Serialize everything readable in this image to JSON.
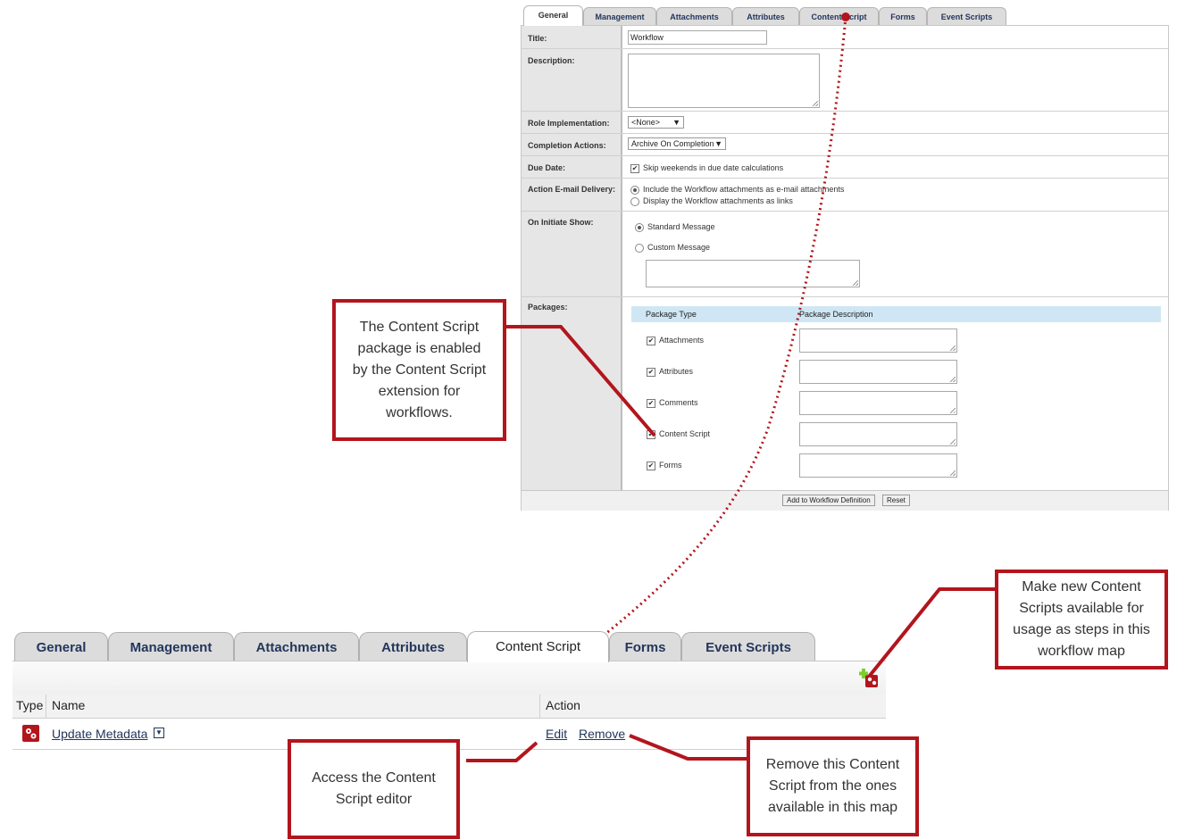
{
  "top": {
    "tabs": [
      {
        "label": "General",
        "active": true
      },
      {
        "label": "Management"
      },
      {
        "label": "Attachments"
      },
      {
        "label": "Attributes"
      },
      {
        "label": "Content Script"
      },
      {
        "label": "Forms"
      },
      {
        "label": "Event Scripts"
      }
    ],
    "form": {
      "title_label": "Title:",
      "title_value": "Workflow",
      "description_label": "Description:",
      "role_label": "Role Implementation:",
      "role_value": "<None>",
      "completion_label": "Completion Actions:",
      "completion_value": "Archive On Completion",
      "due_label": "Due Date:",
      "due_checkbox": "Skip weekends in due date calculations",
      "email_label": "Action E-mail Delivery:",
      "email_opt1": "Include the Workflow attachments as e-mail attachments",
      "email_opt2": "Display the Workflow attachments as links",
      "initiate_label": "On Initiate Show:",
      "initiate_opt1": "Standard Message",
      "initiate_opt2": "Custom Message",
      "packages_label": "Packages:",
      "pkg_col_type": "Package Type",
      "pkg_col_desc": "Package Description",
      "packages": [
        "Attachments",
        "Attributes",
        "Comments",
        "Content Script",
        "Forms"
      ],
      "add_button": "Add to Workflow Definition",
      "reset_button": "Reset"
    }
  },
  "bottom": {
    "tabs": [
      {
        "label": "General"
      },
      {
        "label": "Management"
      },
      {
        "label": "Attachments"
      },
      {
        "label": "Attributes"
      },
      {
        "label": "Content Script",
        "active": true
      },
      {
        "label": "Forms"
      },
      {
        "label": "Event Scripts"
      }
    ],
    "columns": {
      "type": "Type",
      "name": "Name",
      "action": "Action"
    },
    "row": {
      "name": "Update Metadata",
      "edit": "Edit",
      "remove": "Remove"
    }
  },
  "callouts": {
    "package": "The Content Script package is enabled by the Content Script extension for workflows.",
    "new_scripts": "Make new Content Scripts available for usage as steps in this workflow map",
    "editor": "Access the Content Script editor",
    "remove": "Remove this Content Script from the ones available in this map"
  },
  "colors": {
    "accent": "#b3151d",
    "tab_text": "#23365c",
    "pkg_header": "#cfe7f5"
  }
}
